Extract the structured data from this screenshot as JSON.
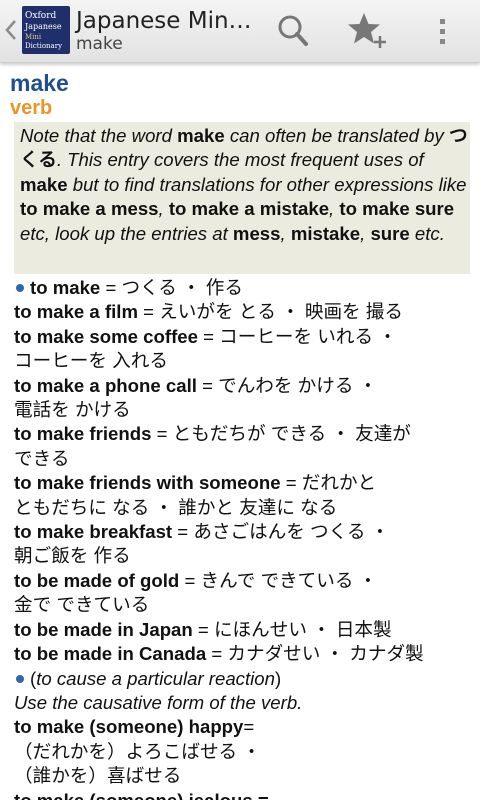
{
  "app": {
    "title": "Japanese Min…",
    "subtitle": "make",
    "icon_text": [
      "Oxford",
      "Japanese",
      "Mini",
      "Dictionary"
    ]
  },
  "toolbar": {
    "up_icon": "chevron-left-icon",
    "search_icon": "search-icon",
    "favorite_icon": "star-add-icon",
    "overflow_icon": "overflow-menu-icon"
  },
  "entry": {
    "headword": "make",
    "part_of_speech": "verb",
    "note": {
      "s1": "Note that the word ",
      "b1": "make",
      "s2": " can often be translated by ",
      "b2": "つくる",
      "s3": ". This entry covers the most frequent uses of ",
      "b3": "make",
      "s4": " but to find translations for other expressions like ",
      "b4": "to make a mess",
      "s5": ", ",
      "b5": "to make a mistake",
      "s6": ", ",
      "b6": "to make sure",
      "s7": " etc, look up the entries at ",
      "b7": "mess",
      "s8": ", ",
      "b8": "mistake",
      "s9": ", ",
      "b9": "sure",
      "s10": " etc."
    },
    "sense1": {
      "phrase": "to make",
      "translation": " = つくる ・ 作る",
      "examples": [
        {
          "phrase": "to make a film",
          "t1": " = えいがを とる ・ 映画を 撮る",
          "t2": ""
        },
        {
          "phrase": "to make some coffee",
          "t1": " = コーヒーを いれる ・",
          "t2": "コーヒーを 入れる"
        },
        {
          "phrase": "to make a phone call",
          "t1": " = でんわを かける ・",
          "t2": "電話を かける"
        },
        {
          "phrase": "to make friends",
          "t1": " = ともだちが できる ・ 友達が",
          "t2": "できる"
        },
        {
          "phrase": "to make friends with someone",
          "t1": " = だれかと",
          "t2": "ともだちに なる ・ 誰かと 友達に なる"
        },
        {
          "phrase": "to make breakfast",
          "t1": " = あさごはんを つくる ・",
          "t2": "朝ご飯を 作る"
        },
        {
          "phrase": "to be made of gold",
          "t1": " = きんで できている ・",
          "t2": "金で できている"
        },
        {
          "phrase": "to be made in Japan",
          "t1": " = にほんせい ・ 日本製",
          "t2": ""
        },
        {
          "phrase": "to be made in Canada",
          "t1": " = カナダせい ・ カナダ製",
          "t2": ""
        }
      ]
    },
    "sense2": {
      "gloss": "(to cause a particular reaction)",
      "instruction": "Use the causative form of the verb.",
      "ex_phrase": "to make (someone) happy",
      "ex_t1": "=",
      "ex_t2": "（だれかを）よろこばせる ・",
      "ex_t3": "（誰かを）喜ばせる",
      "next_partial": "to make (someone) jealous ="
    }
  }
}
